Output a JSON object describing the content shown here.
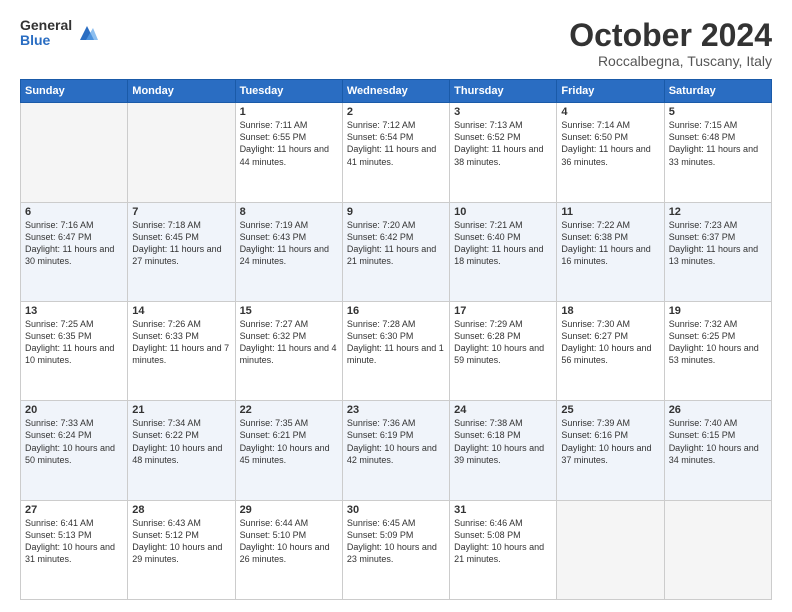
{
  "logo": {
    "general": "General",
    "blue": "Blue"
  },
  "title": "October 2024",
  "location": "Roccalbegna, Tuscany, Italy",
  "days_header": [
    "Sunday",
    "Monday",
    "Tuesday",
    "Wednesday",
    "Thursday",
    "Friday",
    "Saturday"
  ],
  "weeks": [
    {
      "alt": false,
      "days": [
        {
          "num": "",
          "info": "",
          "empty": true
        },
        {
          "num": "",
          "info": "",
          "empty": true
        },
        {
          "num": "1",
          "info": "Sunrise: 7:11 AM\nSunset: 6:55 PM\nDaylight: 11 hours and 44 minutes.",
          "empty": false
        },
        {
          "num": "2",
          "info": "Sunrise: 7:12 AM\nSunset: 6:54 PM\nDaylight: 11 hours and 41 minutes.",
          "empty": false
        },
        {
          "num": "3",
          "info": "Sunrise: 7:13 AM\nSunset: 6:52 PM\nDaylight: 11 hours and 38 minutes.",
          "empty": false
        },
        {
          "num": "4",
          "info": "Sunrise: 7:14 AM\nSunset: 6:50 PM\nDaylight: 11 hours and 36 minutes.",
          "empty": false
        },
        {
          "num": "5",
          "info": "Sunrise: 7:15 AM\nSunset: 6:48 PM\nDaylight: 11 hours and 33 minutes.",
          "empty": false
        }
      ]
    },
    {
      "alt": true,
      "days": [
        {
          "num": "6",
          "info": "Sunrise: 7:16 AM\nSunset: 6:47 PM\nDaylight: 11 hours and 30 minutes.",
          "empty": false
        },
        {
          "num": "7",
          "info": "Sunrise: 7:18 AM\nSunset: 6:45 PM\nDaylight: 11 hours and 27 minutes.",
          "empty": false
        },
        {
          "num": "8",
          "info": "Sunrise: 7:19 AM\nSunset: 6:43 PM\nDaylight: 11 hours and 24 minutes.",
          "empty": false
        },
        {
          "num": "9",
          "info": "Sunrise: 7:20 AM\nSunset: 6:42 PM\nDaylight: 11 hours and 21 minutes.",
          "empty": false
        },
        {
          "num": "10",
          "info": "Sunrise: 7:21 AM\nSunset: 6:40 PM\nDaylight: 11 hours and 18 minutes.",
          "empty": false
        },
        {
          "num": "11",
          "info": "Sunrise: 7:22 AM\nSunset: 6:38 PM\nDaylight: 11 hours and 16 minutes.",
          "empty": false
        },
        {
          "num": "12",
          "info": "Sunrise: 7:23 AM\nSunset: 6:37 PM\nDaylight: 11 hours and 13 minutes.",
          "empty": false
        }
      ]
    },
    {
      "alt": false,
      "days": [
        {
          "num": "13",
          "info": "Sunrise: 7:25 AM\nSunset: 6:35 PM\nDaylight: 11 hours and 10 minutes.",
          "empty": false
        },
        {
          "num": "14",
          "info": "Sunrise: 7:26 AM\nSunset: 6:33 PM\nDaylight: 11 hours and 7 minutes.",
          "empty": false
        },
        {
          "num": "15",
          "info": "Sunrise: 7:27 AM\nSunset: 6:32 PM\nDaylight: 11 hours and 4 minutes.",
          "empty": false
        },
        {
          "num": "16",
          "info": "Sunrise: 7:28 AM\nSunset: 6:30 PM\nDaylight: 11 hours and 1 minute.",
          "empty": false
        },
        {
          "num": "17",
          "info": "Sunrise: 7:29 AM\nSunset: 6:28 PM\nDaylight: 10 hours and 59 minutes.",
          "empty": false
        },
        {
          "num": "18",
          "info": "Sunrise: 7:30 AM\nSunset: 6:27 PM\nDaylight: 10 hours and 56 minutes.",
          "empty": false
        },
        {
          "num": "19",
          "info": "Sunrise: 7:32 AM\nSunset: 6:25 PM\nDaylight: 10 hours and 53 minutes.",
          "empty": false
        }
      ]
    },
    {
      "alt": true,
      "days": [
        {
          "num": "20",
          "info": "Sunrise: 7:33 AM\nSunset: 6:24 PM\nDaylight: 10 hours and 50 minutes.",
          "empty": false
        },
        {
          "num": "21",
          "info": "Sunrise: 7:34 AM\nSunset: 6:22 PM\nDaylight: 10 hours and 48 minutes.",
          "empty": false
        },
        {
          "num": "22",
          "info": "Sunrise: 7:35 AM\nSunset: 6:21 PM\nDaylight: 10 hours and 45 minutes.",
          "empty": false
        },
        {
          "num": "23",
          "info": "Sunrise: 7:36 AM\nSunset: 6:19 PM\nDaylight: 10 hours and 42 minutes.",
          "empty": false
        },
        {
          "num": "24",
          "info": "Sunrise: 7:38 AM\nSunset: 6:18 PM\nDaylight: 10 hours and 39 minutes.",
          "empty": false
        },
        {
          "num": "25",
          "info": "Sunrise: 7:39 AM\nSunset: 6:16 PM\nDaylight: 10 hours and 37 minutes.",
          "empty": false
        },
        {
          "num": "26",
          "info": "Sunrise: 7:40 AM\nSunset: 6:15 PM\nDaylight: 10 hours and 34 minutes.",
          "empty": false
        }
      ]
    },
    {
      "alt": false,
      "days": [
        {
          "num": "27",
          "info": "Sunrise: 6:41 AM\nSunset: 5:13 PM\nDaylight: 10 hours and 31 minutes.",
          "empty": false
        },
        {
          "num": "28",
          "info": "Sunrise: 6:43 AM\nSunset: 5:12 PM\nDaylight: 10 hours and 29 minutes.",
          "empty": false
        },
        {
          "num": "29",
          "info": "Sunrise: 6:44 AM\nSunset: 5:10 PM\nDaylight: 10 hours and 26 minutes.",
          "empty": false
        },
        {
          "num": "30",
          "info": "Sunrise: 6:45 AM\nSunset: 5:09 PM\nDaylight: 10 hours and 23 minutes.",
          "empty": false
        },
        {
          "num": "31",
          "info": "Sunrise: 6:46 AM\nSunset: 5:08 PM\nDaylight: 10 hours and 21 minutes.",
          "empty": false
        },
        {
          "num": "",
          "info": "",
          "empty": true
        },
        {
          "num": "",
          "info": "",
          "empty": true
        }
      ]
    }
  ]
}
